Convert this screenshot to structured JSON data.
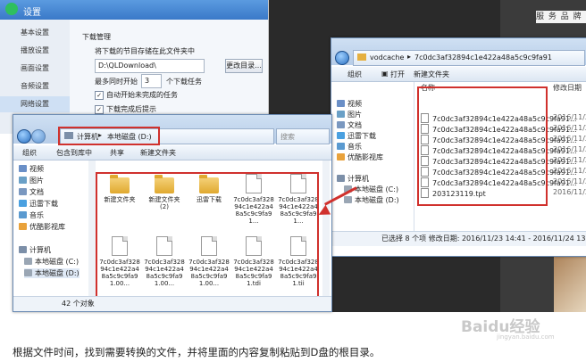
{
  "settings": {
    "title": "设置",
    "sidebar": [
      "基本设置",
      "播放设置",
      "画面设置",
      "音频设置",
      "网络设置"
    ],
    "section": "下载管理",
    "save_label": "将下载的节目存储在此文件夹中",
    "path_value": "D:\\QLDownload\\",
    "change_button": "更改目录...",
    "max_tasks_prefix": "最多同时开始",
    "max_tasks_value": "3",
    "max_tasks_suffix": "个下载任务",
    "auto_start": "自动开始未完成的任务",
    "after_done": "下载完成后提示"
  },
  "explorer_left": {
    "breadcrumb": [
      "计算机",
      "本地磁盘 (D:)"
    ],
    "search_placeholder": "搜索",
    "toolbar": [
      "组织",
      "包含到库中",
      "共享",
      "新建文件夹"
    ],
    "nav": [
      {
        "label": "视频",
        "color": "#6a8fc7"
      },
      {
        "label": "图片",
        "color": "#6aa0c7"
      },
      {
        "label": "文档",
        "color": "#7a98c0"
      },
      {
        "label": "迅雷下载",
        "color": "#4aa0e0"
      },
      {
        "label": "音乐",
        "color": "#5a9ad0"
      },
      {
        "label": "优酷影视库",
        "color": "#e9a23b"
      },
      {
        "label": "计算机",
        "color": "#7c8fa8"
      },
      {
        "label": "本地磁盘 (C:)",
        "color": "#9aa6b4"
      },
      {
        "label": "本地磁盘 (D:)",
        "color": "#9aa6b4"
      }
    ],
    "tiles": [
      {
        "label": "新建文件夹",
        "kind": "folder"
      },
      {
        "label": "新建文件夹 (2)",
        "kind": "folder"
      },
      {
        "label": "迅雷下载",
        "kind": "folder"
      },
      {
        "label": "7c0dc3af32894c1e422a48a5c9c9fa91...",
        "kind": "doc"
      },
      {
        "label": "7c0dc3af32894c1e422a48a5c9c9fa91...",
        "kind": "doc"
      },
      {
        "label": "7c0dc3af32894c1e422a48a5c9c9fa91.00...",
        "kind": "doc"
      },
      {
        "label": "7c0dc3af32894c1e422a48a5c9c9fa91.00...",
        "kind": "doc"
      },
      {
        "label": "7c0dc3af32894c1e422a48a5c9c9fa91.00...",
        "kind": "doc"
      },
      {
        "label": "7c0dc3af32894c1e422a48a5c9c9fa91.tdi",
        "kind": "doc"
      },
      {
        "label": "7c0dc3af32894c1e422a48a5c9c9fa91.tii",
        "kind": "doc"
      }
    ],
    "status": "42 个对象"
  },
  "explorer_right": {
    "breadcrumb": [
      "vodcache",
      "7c0dc3af32894c1e422a48a5c9c9fa91"
    ],
    "toolbar": [
      "组织",
      "打开",
      "新建文件夹"
    ],
    "col_name": "名称",
    "col_date": "修改日期",
    "nav": [
      {
        "label": "视频",
        "color": "#6a8fc7"
      },
      {
        "label": "图片",
        "color": "#6aa0c7"
      },
      {
        "label": "文档",
        "color": "#7a98c0"
      },
      {
        "label": "迅雷下载",
        "color": "#4aa0e0"
      },
      {
        "label": "音乐",
        "color": "#5a9ad0"
      },
      {
        "label": "优酷影视库",
        "color": "#e9a23b"
      },
      {
        "label": "计算机",
        "color": "#7c8fa8"
      },
      {
        "label": "本地磁盘 (C:)",
        "color": "#9aa6b4"
      },
      {
        "label": "本地磁盘 (D:)",
        "color": "#9aa6b4"
      }
    ],
    "rows": [
      {
        "name": "7c0dc3af32894c1e422a48a5c9c9fa91...",
        "date": "2016/11/2"
      },
      {
        "name": "7c0dc3af32894c1e422a48a5c9c9fa91...",
        "date": "2016/11/2"
      },
      {
        "name": "7c0dc3af32894c1e422a48a5c9c9fa91...",
        "date": "2016/11/2"
      },
      {
        "name": "7c0dc3af32894c1e422a48a5c9c9fa91...",
        "date": "2016/11/2"
      },
      {
        "name": "7c0dc3af32894c1e422a48a5c9c9fa91...",
        "date": "2016/11/2"
      },
      {
        "name": "7c0dc3af32894c1e422a48a5c9c9fa91...",
        "date": "2016/11/2"
      },
      {
        "name": "7c0dc3af32894c1e422a48a5c9c9fa91...",
        "date": "2016/11/2"
      },
      {
        "name": "203123119.tpt",
        "date": "2016/11/2"
      }
    ],
    "status": "已选择 8 个项  修改日期: 2016/11/23 14:41 - 2016/11/24 13:41"
  },
  "banner": "服 务 品 牌",
  "caption": "根据文件时间，找到需要转换的文件，并将里面的内容复制粘贴到D盘的根目录。",
  "watermark": "Baidu经验",
  "watermark_sub": "jingyan.baidu.com",
  "accent_red": "#d0312d"
}
